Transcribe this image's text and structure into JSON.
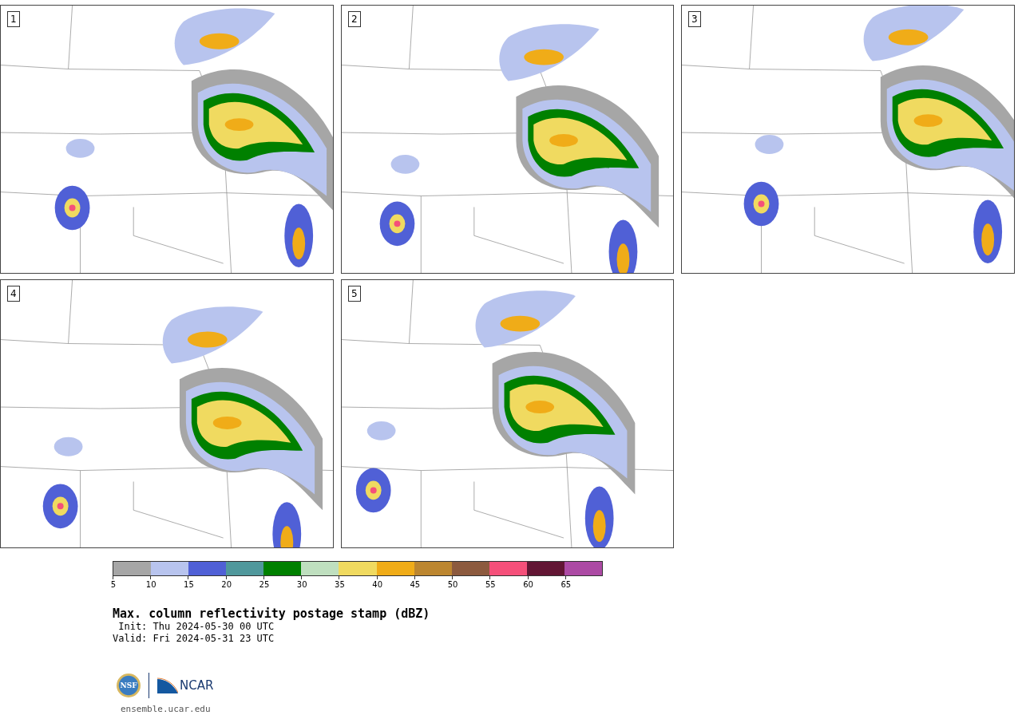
{
  "panels": [
    {
      "label": "1"
    },
    {
      "label": "2"
    },
    {
      "label": "3"
    },
    {
      "label": "4"
    },
    {
      "label": "5"
    }
  ],
  "colorbar": {
    "bins": [
      {
        "color": "#a6a6a6"
      },
      {
        "color": "#b8c4ee"
      },
      {
        "color": "#5060d6"
      },
      {
        "color": "#50989c"
      },
      {
        "color": "#008000"
      },
      {
        "color": "#bfdfbf"
      },
      {
        "color": "#f0da60"
      },
      {
        "color": "#f0ac18"
      },
      {
        "color": "#bc8630"
      },
      {
        "color": "#8c5a3e"
      },
      {
        "color": "#f5507a"
      },
      {
        "color": "#621634"
      },
      {
        "color": "#ac4aa4"
      }
    ],
    "ticks": [
      "5",
      "10",
      "15",
      "20",
      "25",
      "30",
      "35",
      "40",
      "45",
      "50",
      "55",
      "60",
      "65"
    ]
  },
  "title": "Max. column reflectivity postage stamp (dBZ)",
  "init": " Init: Thu 2024-05-30 00 UTC",
  "valid": "Valid: Fri 2024-05-31 23 UTC",
  "logos": {
    "nsf": "NSF",
    "ncar": "NCAR"
  },
  "footer": "ensemble.ucar.edu"
}
